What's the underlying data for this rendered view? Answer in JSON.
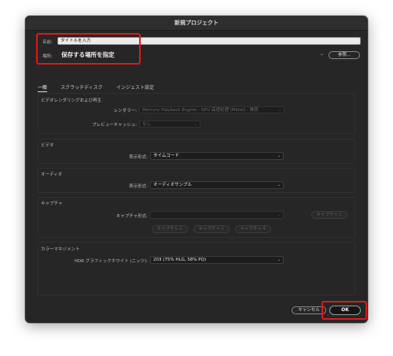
{
  "window": {
    "title": "新規プロジェクト"
  },
  "name_field": {
    "label": "名前:",
    "value": "タイトルを入力"
  },
  "location": {
    "label": "場所:",
    "value": "保存する場所を指定",
    "browse_label": "参照..."
  },
  "tabs": [
    {
      "label": "一般",
      "active": true
    },
    {
      "label": "スクラッチディスク",
      "active": false
    },
    {
      "label": "インジェスト設定",
      "active": false
    }
  ],
  "video_rendering": {
    "title": "ビデオレンダリングおよび再生",
    "renderer_label": "レンダラー:",
    "renderer_value": "Mercury Playback Engine - GPU 高速処理 (Metal) - 推奨",
    "preview_cache_label": "プレビューキャッシュ:",
    "preview_cache_value": "なし"
  },
  "video": {
    "title": "ビデオ",
    "display_format_label": "表示形式:",
    "display_format_value": "タイムコード"
  },
  "audio": {
    "title": "オーディオ",
    "display_format_label": "表示形式:",
    "display_format_value": "オーディオサンプル"
  },
  "capture": {
    "title": "キャプチャ",
    "format_label": "キャプチャ形式:",
    "format_value": "",
    "buttons": [
      "キャプチャ１",
      "キャプチャ２",
      "キャプチャ３",
      "キャプチャ４"
    ]
  },
  "color_management": {
    "title": "カラーマネジメント",
    "hdr_label": "HDR グラフィックホワイト (ニッツ):",
    "hdr_value": "203 (75% HLG, 58% PQ)"
  },
  "footer": {
    "cancel_label": "キャンセル",
    "ok_label": "OK"
  },
  "colors": {
    "highlight": "#e01919",
    "window_bg": "#262626"
  }
}
